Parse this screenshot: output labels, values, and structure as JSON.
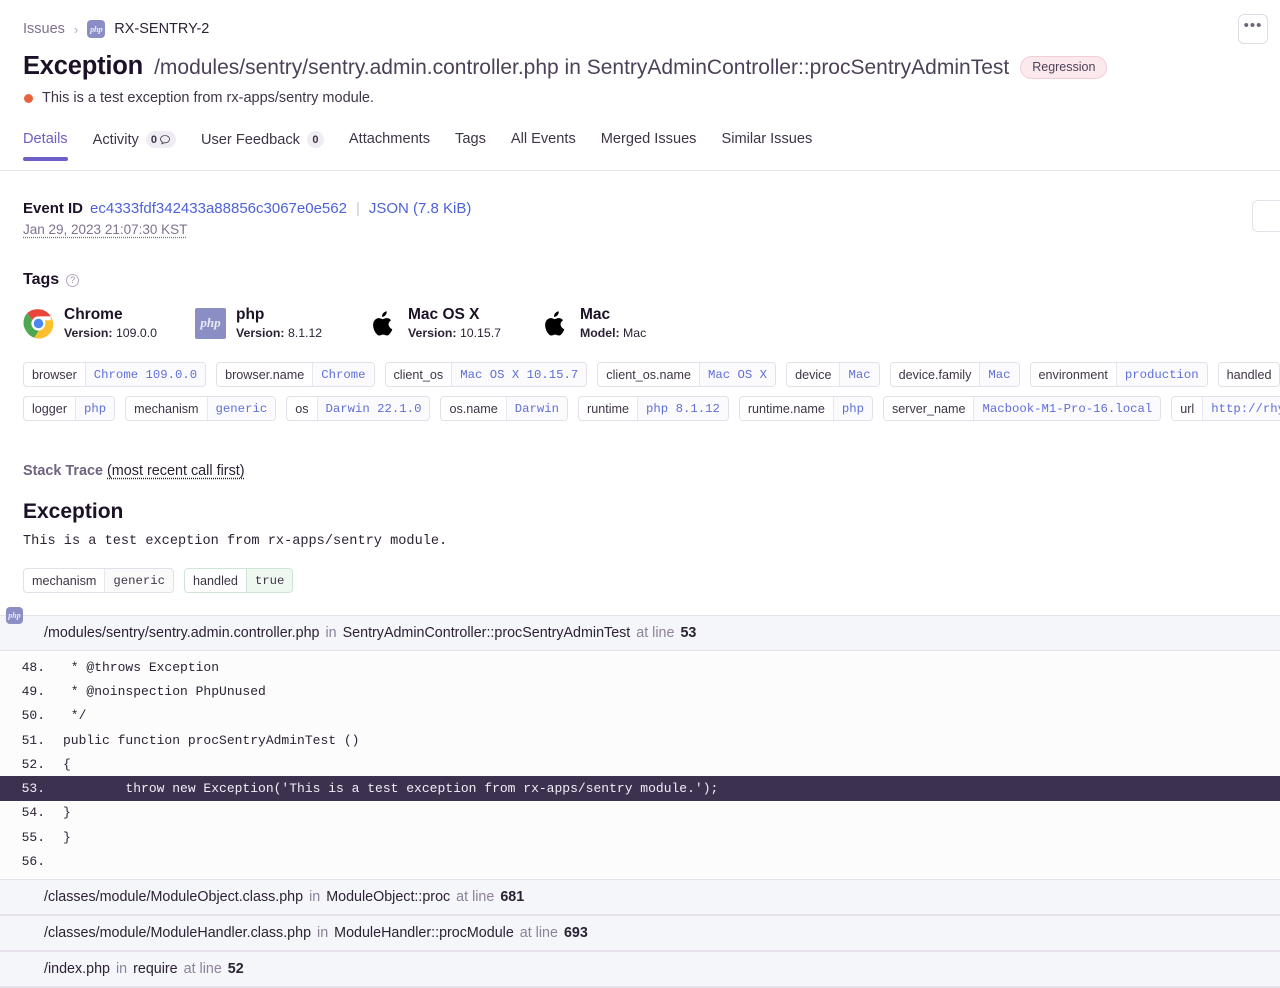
{
  "breadcrumb": {
    "root_label": "Issues",
    "separator": "›",
    "project_icon": "php-icon",
    "project_badge_text": "php",
    "current_label": "RX-SENTRY-2"
  },
  "header": {
    "actions_button_label": "•••",
    "title_type": "Exception",
    "title_culprit": "/modules/sentry/sentry.admin.controller.php in SentryAdminController::procSentryAdminTest",
    "badge": "Regression",
    "level_color": "#e8643c",
    "message": "This is a test exception from rx-apps/sentry module."
  },
  "tabs": [
    {
      "label": "Details",
      "count": null,
      "active": true
    },
    {
      "label": "Activity",
      "count": "0",
      "has_comment_icon": true,
      "active": false
    },
    {
      "label": "User Feedback",
      "count": "0",
      "active": false
    },
    {
      "label": "Attachments",
      "count": null,
      "active": false
    },
    {
      "label": "Tags",
      "count": null,
      "active": false
    },
    {
      "label": "All Events",
      "count": null,
      "active": false
    },
    {
      "label": "Merged Issues",
      "count": null,
      "active": false
    },
    {
      "label": "Similar Issues",
      "count": null,
      "active": false
    }
  ],
  "event": {
    "id_label": "Event ID",
    "id_value": "ec4333fdf342433a88856c3067e0e562",
    "separator": "|",
    "json_link": "JSON (7.8 KiB)",
    "timestamp": "Jan 29, 2023 21:07:30 KST"
  },
  "tags_section": {
    "title": "Tags",
    "help_icon": "question-mark-icon",
    "summary": [
      {
        "icon": "chrome-icon",
        "name": "Chrome",
        "meta_label": "Version:",
        "meta_value": "109.0.0"
      },
      {
        "icon": "php-icon",
        "name": "php",
        "meta_label": "Version:",
        "meta_value": "8.1.12"
      },
      {
        "icon": "apple-icon",
        "name": "Mac OS X",
        "meta_label": "Version:",
        "meta_value": "10.15.7"
      },
      {
        "icon": "apple-icon",
        "name": "Mac",
        "meta_label": "Model:",
        "meta_value": "Mac"
      }
    ],
    "pill_rows": [
      [
        {
          "key": "browser",
          "value": "Chrome 109.0.0"
        },
        {
          "key": "browser.name",
          "value": "Chrome"
        },
        {
          "key": "client_os",
          "value": "Mac OS X 10.15.7"
        },
        {
          "key": "client_os.name",
          "value": "Mac OS X"
        },
        {
          "key": "device",
          "value": "Mac"
        },
        {
          "key": "device.family",
          "value": "Mac"
        },
        {
          "key": "environment",
          "value": "production"
        },
        {
          "key": "handled",
          "value": ""
        }
      ],
      [
        {
          "key": "logger",
          "value": "php"
        },
        {
          "key": "mechanism",
          "value": "generic"
        },
        {
          "key": "os",
          "value": "Darwin 22.1.0"
        },
        {
          "key": "os.name",
          "value": "Darwin"
        },
        {
          "key": "runtime",
          "value": "php 8.1.12"
        },
        {
          "key": "runtime.name",
          "value": "php"
        },
        {
          "key": "server_name",
          "value": "Macbook-M1-Pro-16.local"
        },
        {
          "key": "url",
          "value": "http://rhy"
        }
      ]
    ]
  },
  "stack_trace": {
    "heading_label": "Stack Trace",
    "heading_order": "(most recent call first)",
    "exception_title": "Exception",
    "exception_message": "This is a test exception from rx-apps/sentry module.",
    "exception_pills": [
      {
        "key": "mechanism",
        "value": "generic",
        "highlight": false
      },
      {
        "key": "handled",
        "value": "true",
        "highlight": true
      }
    ],
    "frames": [
      {
        "file": "/modules/sentry/sentry.admin.controller.php",
        "in_label": "in",
        "function": "SentryAdminController::procSentryAdminTest",
        "at_label": "at line",
        "line": "53",
        "expanded": true,
        "platform_icon": "php-icon",
        "code": [
          {
            "n": "48.",
            "text": " * @throws Exception",
            "highlight": false
          },
          {
            "n": "49.",
            "text": " * @noinspection PhpUnused",
            "highlight": false
          },
          {
            "n": "50.",
            "text": " */",
            "highlight": false
          },
          {
            "n": "51.",
            "text": "public function procSentryAdminTest ()",
            "highlight": false
          },
          {
            "n": "52.",
            "text": "{",
            "highlight": false
          },
          {
            "n": "53.",
            "text": "        throw new Exception('This is a test exception from rx-apps/sentry module.');",
            "highlight": true
          },
          {
            "n": "54.",
            "text": "}",
            "highlight": false
          },
          {
            "n": "55.",
            "text": "}",
            "highlight": false
          },
          {
            "n": "56.",
            "text": "",
            "highlight": false
          }
        ]
      },
      {
        "file": "/classes/module/ModuleObject.class.php",
        "in_label": "in",
        "function": "ModuleObject::proc",
        "at_label": "at line",
        "line": "681",
        "expanded": false,
        "code": []
      },
      {
        "file": "/classes/module/ModuleHandler.class.php",
        "in_label": "in",
        "function": "ModuleHandler::procModule",
        "at_label": "at line",
        "line": "693",
        "expanded": false,
        "code": []
      },
      {
        "file": "/index.php",
        "in_label": "in",
        "function": "require",
        "at_label": "at line",
        "line": "52",
        "expanded": false,
        "code": []
      }
    ]
  },
  "colors": {
    "accent": "#6c5fc7",
    "link": "#4e62d6",
    "level_error": "#e8643c",
    "badge_bg": "#fbe9ee",
    "code_highlight_bg": "#3d3150"
  }
}
